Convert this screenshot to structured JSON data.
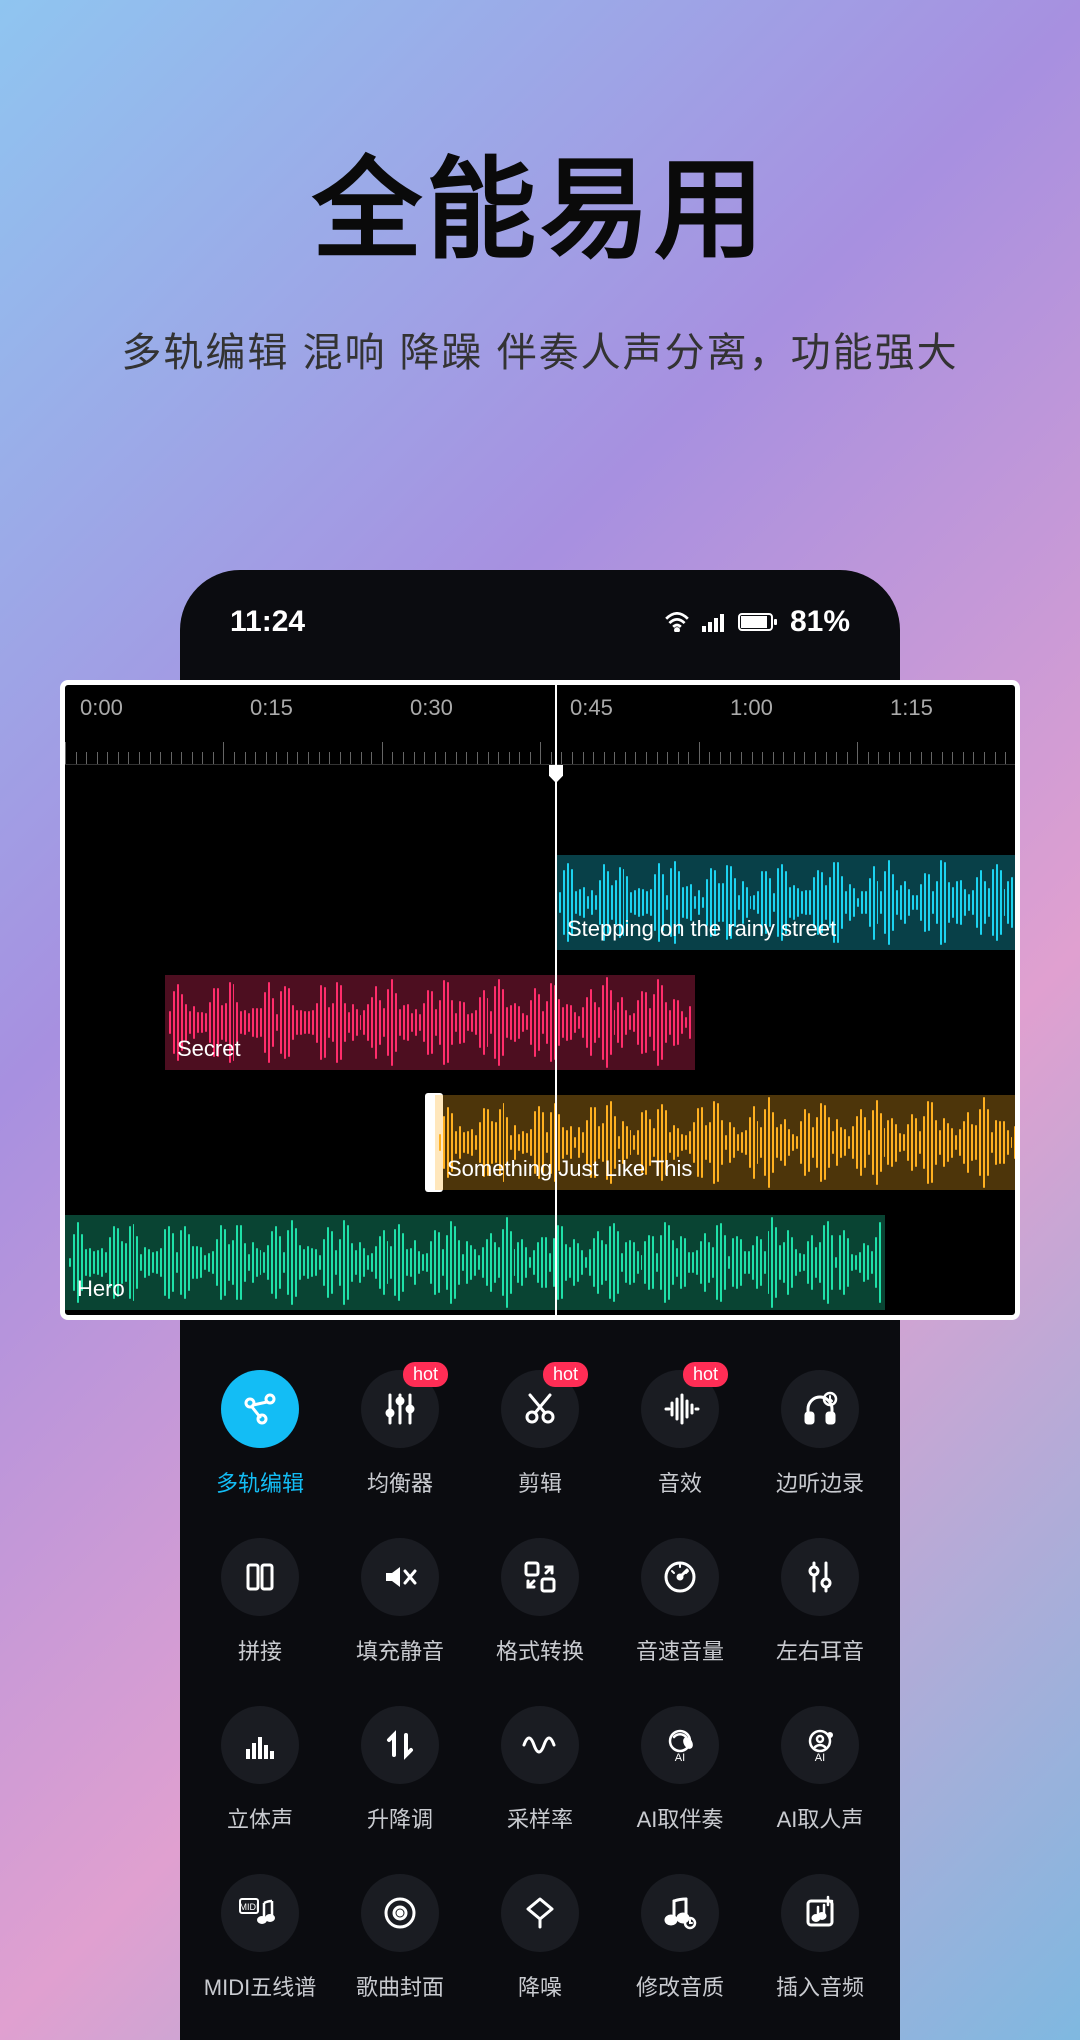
{
  "hero": {
    "title": "全能易用",
    "subtitle": "多轨编辑  混响  降躁  伴奏人声分离，功能强大"
  },
  "statusbar": {
    "time": "11:24",
    "battery": "81%"
  },
  "timeline": {
    "marks": [
      "0:00",
      "0:15",
      "0:30",
      "0:45",
      "1:00",
      "1:15"
    ],
    "tracks": [
      {
        "name": "Stepping on the rainy street",
        "color": "#1cd3f0"
      },
      {
        "name": "Secret",
        "color": "#ff2d6b"
      },
      {
        "name": "Something Just Like This",
        "color": "#ffb020"
      },
      {
        "name": "Hero",
        "color": "#1fe0a8"
      }
    ]
  },
  "tools": [
    {
      "label": "多轨编辑",
      "icon": "multitrack",
      "active": true,
      "hot": false
    },
    {
      "label": "均衡器",
      "icon": "equalizer",
      "active": false,
      "hot": true
    },
    {
      "label": "剪辑",
      "icon": "scissors",
      "active": false,
      "hot": true
    },
    {
      "label": "音效",
      "icon": "soundfx",
      "active": false,
      "hot": true
    },
    {
      "label": "边听边录",
      "icon": "headphones",
      "active": false,
      "hot": false
    },
    {
      "label": "拼接",
      "icon": "columns",
      "active": false,
      "hot": false
    },
    {
      "label": "填充静音",
      "icon": "mute",
      "active": false,
      "hot": false
    },
    {
      "label": "格式转换",
      "icon": "convert",
      "active": false,
      "hot": false
    },
    {
      "label": "音速音量",
      "icon": "gauge",
      "active": false,
      "hot": false
    },
    {
      "label": "左右耳音",
      "icon": "stereo-sliders",
      "active": false,
      "hot": false
    },
    {
      "label": "立体声",
      "icon": "bars",
      "active": false,
      "hot": false
    },
    {
      "label": "升降调",
      "icon": "pitch",
      "active": false,
      "hot": false
    },
    {
      "label": "采样率",
      "icon": "samplerate",
      "active": false,
      "hot": false
    },
    {
      "label": "AI取伴奏",
      "icon": "ai-accomp",
      "active": false,
      "hot": false
    },
    {
      "label": "AI取人声",
      "icon": "ai-vocal",
      "active": false,
      "hot": false
    },
    {
      "label": "MIDI五线谱",
      "icon": "midi",
      "active": false,
      "hot": false
    },
    {
      "label": "歌曲封面",
      "icon": "disc",
      "active": false,
      "hot": false
    },
    {
      "label": "降噪",
      "icon": "denoise",
      "active": false,
      "hot": false
    },
    {
      "label": "修改音质",
      "icon": "quality",
      "active": false,
      "hot": false
    },
    {
      "label": "插入音频",
      "icon": "insert",
      "active": false,
      "hot": false
    }
  ],
  "hot_label": "hot"
}
